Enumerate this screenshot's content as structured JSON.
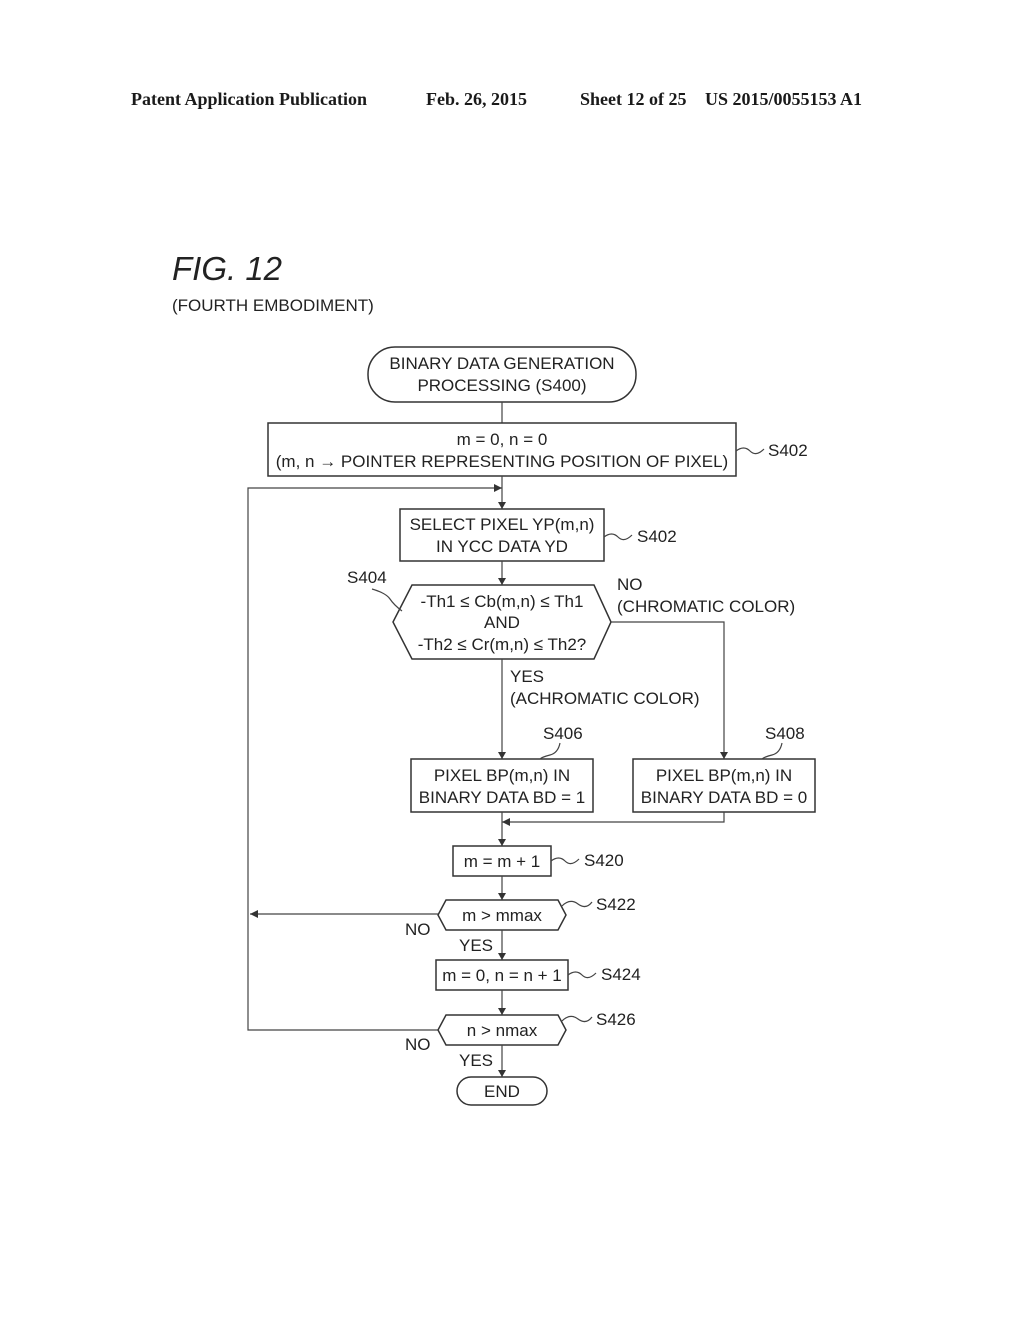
{
  "header": {
    "publication": "Patent Application Publication",
    "date": "Feb. 26, 2015",
    "sheet": "Sheet 12 of 25",
    "number": "US 2015/0055153 A1"
  },
  "figure": {
    "title": "FIG. 12",
    "subtitle": "(FOURTH EMBODIMENT)"
  },
  "flowchart": {
    "start": {
      "line1": "BINARY DATA GENERATION",
      "line2": "PROCESSING (S400)"
    },
    "init": {
      "line1": "m = 0, n = 0",
      "line2": "(m, n → POINTER REPRESENTING POSITION OF PIXEL)",
      "ref": "S402"
    },
    "select": {
      "line1": "SELECT PIXEL YP(m,n)",
      "line2": "IN YCC DATA YD",
      "ref": "S402"
    },
    "decision": {
      "ref": "S404",
      "line1": "-Th1 ≤ Cb(m,n) ≤ Th1",
      "line2": "AND",
      "line3": "-Th2 ≤ Cr(m,n) ≤ Th2?",
      "no_label": "NO",
      "no_detail": "(CHROMATIC COLOR)",
      "yes_label": "YES",
      "yes_detail": "(ACHROMATIC COLOR)"
    },
    "set_one": {
      "ref": "S406",
      "line1": "PIXEL BP(m,n) IN",
      "line2": "BINARY DATA BD = 1"
    },
    "set_zero": {
      "ref": "S408",
      "line1": "PIXEL BP(m,n) IN",
      "line2": "BINARY DATA BD = 0"
    },
    "inc_m": {
      "text": "m = m + 1",
      "ref": "S420"
    },
    "check_m": {
      "text": "m > mmax",
      "ref": "S422",
      "no_label": "NO",
      "yes_label": "YES"
    },
    "reset_m": {
      "text": "m = 0, n = n + 1",
      "ref": "S424"
    },
    "check_n": {
      "text": "n > nmax",
      "ref": "S426",
      "no_label": "NO",
      "yes_label": "YES"
    },
    "end": {
      "text": "END"
    }
  }
}
